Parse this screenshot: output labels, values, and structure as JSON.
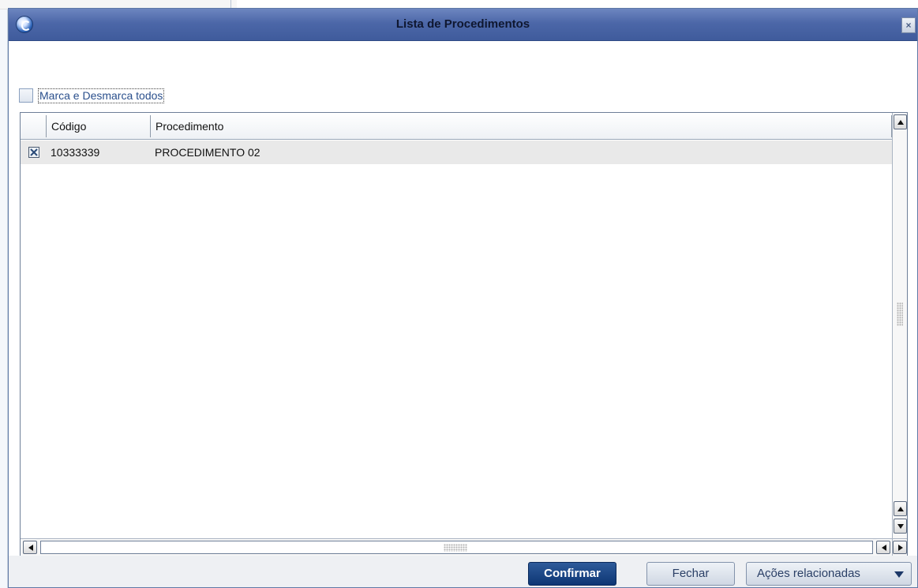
{
  "dialog": {
    "title": "Lista de Procedimentos",
    "close_glyph": "×",
    "logo_icon": "app-logo-icon"
  },
  "select_all": {
    "label": "Marca e Desmarca todos",
    "checked": false
  },
  "table": {
    "columns": [
      "",
      "Código",
      "Procedimento"
    ],
    "rows": [
      {
        "checked": true,
        "codigo": "10333339",
        "procedimento": "PROCEDIMENTO 02"
      }
    ]
  },
  "footer": {
    "confirm_label": "Confirmar",
    "close_label": "Fechar",
    "actions_label": "Ações relacionadas"
  },
  "colors": {
    "titlebar": "#4c67a8",
    "confirm_button": "#1b4687",
    "link_text": "#2a4f8c",
    "selected_row": "#e9e9e9"
  }
}
